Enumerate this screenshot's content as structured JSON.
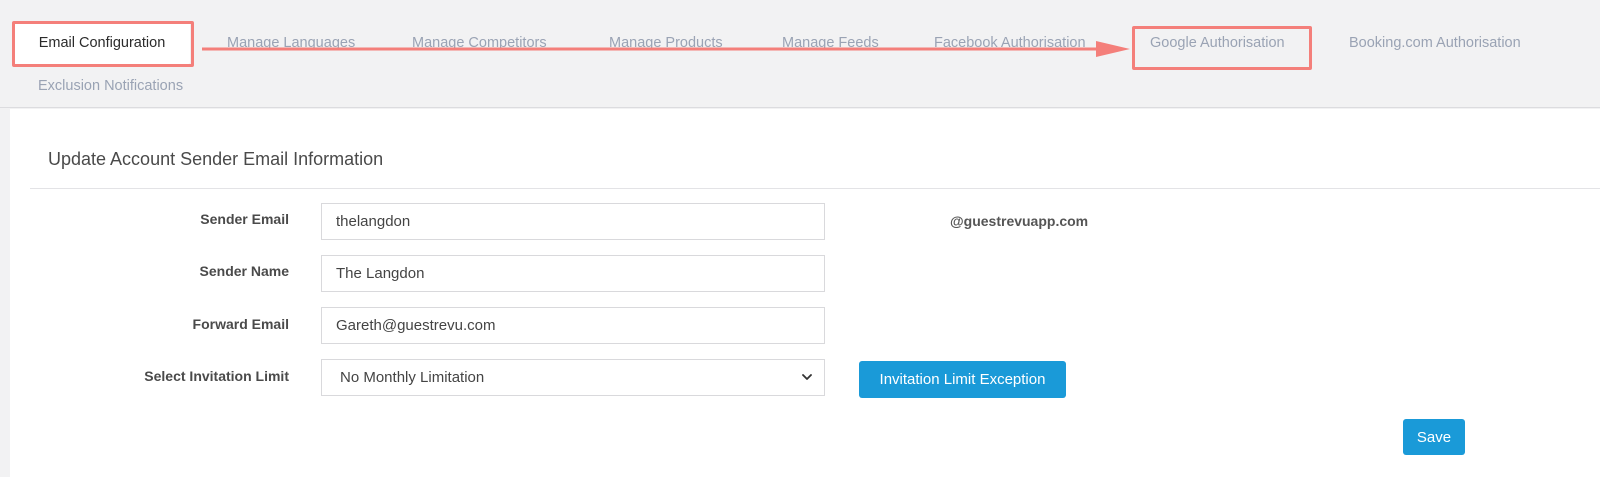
{
  "tabs": [
    {
      "id": "email",
      "label": "Email Configuration",
      "active": true
    },
    {
      "id": "languages",
      "label": "Manage Languages"
    },
    {
      "id": "competitors",
      "label": "Manage Competitors"
    },
    {
      "id": "products",
      "label": "Manage Products"
    },
    {
      "id": "feeds",
      "label": "Manage Feeds"
    },
    {
      "id": "facebook",
      "label": "Facebook Authorisation"
    },
    {
      "id": "google",
      "label": "Google Authorisation"
    },
    {
      "id": "booking",
      "label": "Booking.com Authorisation"
    },
    {
      "id": "exclusion",
      "label": "Exclusion Notifications"
    }
  ],
  "annotation": {
    "color": "#f47f7a",
    "from_tab": "Email Configuration",
    "to_tab": "Google Authorisation"
  },
  "section": {
    "title": "Update Account Sender Email Information"
  },
  "form": {
    "sender_email": {
      "label": "Sender Email",
      "value": "thelangdon",
      "domain": "@guestrevuapp.com"
    },
    "sender_name": {
      "label": "Sender Name",
      "value": "The Langdon"
    },
    "forward_email": {
      "label": "Forward Email",
      "value": "Gareth@guestrevu.com"
    },
    "invitation_limit": {
      "label": "Select Invitation Limit",
      "selected": "No Monthly Limitation"
    }
  },
  "buttons": {
    "exception": "Invitation Limit Exception",
    "save": "Save"
  },
  "colors": {
    "accent": "#1a9ad8",
    "tab_inactive": "#9aa3b4",
    "background": "#f2f2f3"
  }
}
